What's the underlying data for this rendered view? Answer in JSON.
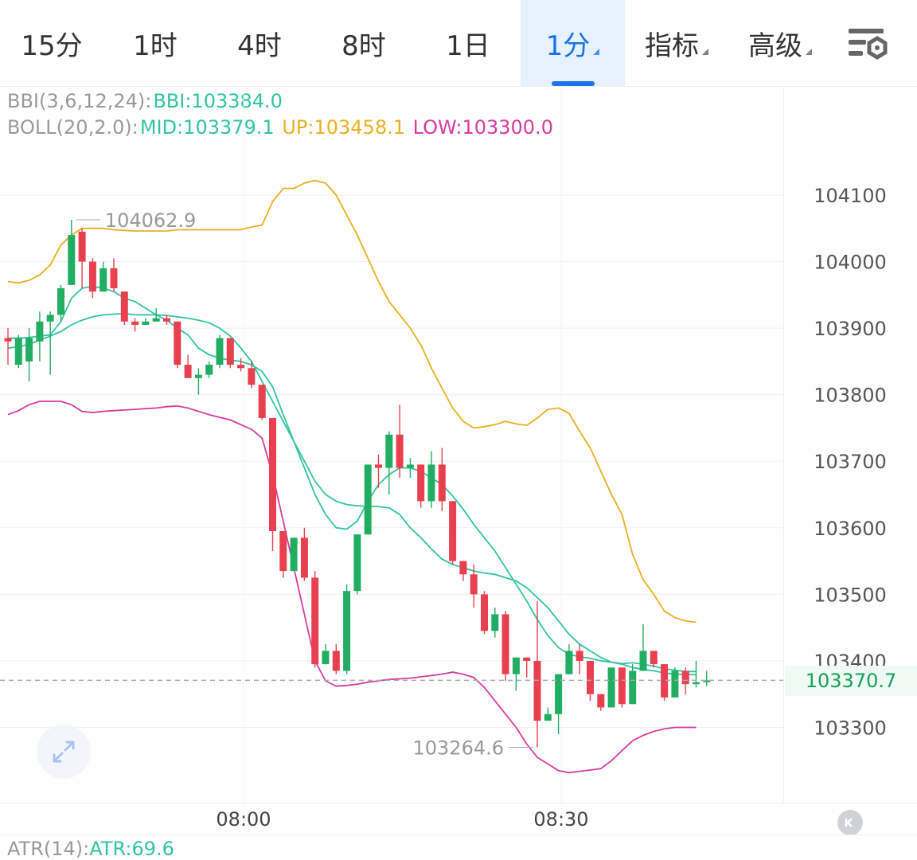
{
  "tabs": [
    {
      "label": "15分"
    },
    {
      "label": "1时"
    },
    {
      "label": "4时"
    },
    {
      "label": "8时"
    },
    {
      "label": "1日"
    },
    {
      "label": "1分"
    },
    {
      "label": "指标"
    },
    {
      "label": "高级"
    }
  ],
  "active_tab": "1分",
  "menu_icon": "settings-list-icon",
  "legend": {
    "bbi_name": "BBI(3,6,12,24):",
    "bbi_value": "BBI:103384.0",
    "boll_name": "BOLL(20,2.0):",
    "boll_mid": "MID:103379.1",
    "boll_up": "UP:103458.1",
    "boll_low": "LOW:103300.0"
  },
  "current_price": "103370.7",
  "atr": {
    "name": "ATR(14):",
    "value": "ATR:69.6"
  },
  "colors": {
    "up": "#21ad62",
    "down": "#e8404f",
    "bbi": "#2fc4a2",
    "mid": "#2fc4a2",
    "upper": "#e9b020",
    "lower": "#d93aa0",
    "accent": "#1a73e8",
    "label": "#999999"
  },
  "chart_data": {
    "type": "candlestick",
    "y_ticks": [
      "104100",
      "104000",
      "103900",
      "103800",
      "103700",
      "103600",
      "103500",
      "103400",
      "103300"
    ],
    "x_ticks": [
      {
        "label": "08:00",
        "index": 20
      },
      {
        "label": "08:30",
        "index": 50
      }
    ],
    "ylim": [
      103220,
      104240
    ],
    "high_label": "104062.9",
    "low_label": "103264.6",
    "current_price": 103370.7,
    "candles": [
      [
        103885,
        103880,
        103900,
        103845
      ],
      [
        103845,
        103885,
        103890,
        103840
      ],
      [
        103850,
        103885,
        103900,
        103820
      ],
      [
        103880,
        103910,
        103925,
        103850
      ],
      [
        103910,
        103920,
        103925,
        103830
      ],
      [
        103920,
        103960,
        103965,
        103910
      ],
      [
        103965,
        104040,
        104062.9,
        103965
      ],
      [
        104045,
        104000,
        104050,
        103960
      ],
      [
        104000,
        103955,
        104005,
        103945
      ],
      [
        103955,
        103990,
        104000,
        103955
      ],
      [
        103990,
        103960,
        104005,
        103955
      ],
      [
        103955,
        103910,
        103955,
        103905
      ],
      [
        103910,
        103905,
        103915,
        103895
      ],
      [
        103905,
        103910,
        103915,
        103905
      ],
      [
        103910,
        103915,
        103930,
        103910
      ],
      [
        103915,
        103910,
        103920,
        103905
      ],
      [
        103910,
        103845,
        103910,
        103840
      ],
      [
        103845,
        103825,
        103860,
        103825
      ],
      [
        103825,
        103830,
        103840,
        103800
      ],
      [
        103830,
        103845,
        103850,
        103825
      ],
      [
        103845,
        103885,
        103890,
        103840
      ],
      [
        103885,
        103845,
        103885,
        103840
      ],
      [
        103845,
        103840,
        103855,
        103835
      ],
      [
        103840,
        103815,
        103850,
        103810
      ],
      [
        103815,
        103765,
        103815,
        103762
      ],
      [
        103765,
        103595,
        103765,
        103565
      ],
      [
        103595,
        103535,
        103595,
        103525
      ],
      [
        103535,
        103585,
        103585,
        103535
      ],
      [
        103585,
        103525,
        103600,
        103520
      ],
      [
        103525,
        103395,
        103535,
        103390
      ],
      [
        103395,
        103415,
        103425,
        103395
      ],
      [
        103415,
        103385,
        103425,
        103380
      ],
      [
        103385,
        103505,
        103515,
        103380
      ],
      [
        103505,
        103590,
        103590,
        103500
      ],
      [
        103590,
        103695,
        103695,
        103590
      ],
      [
        103695,
        103690,
        103710,
        103660
      ],
      [
        103690,
        103740,
        103745,
        103650
      ],
      [
        103740,
        103690,
        103785,
        103675
      ],
      [
        103690,
        103695,
        103705,
        103675
      ],
      [
        103695,
        103640,
        103695,
        103630
      ],
      [
        103640,
        103695,
        103715,
        103630
      ],
      [
        103695,
        103640,
        103720,
        103625
      ],
      [
        103640,
        103550,
        103640,
        103545
      ],
      [
        103550,
        103530,
        103550,
        103520
      ],
      [
        103530,
        103500,
        103545,
        103480
      ],
      [
        103500,
        103445,
        103505,
        103440
      ],
      [
        103445,
        103470,
        103480,
        103435
      ],
      [
        103470,
        103380,
        103475,
        103370
      ],
      [
        103380,
        103405,
        103405,
        103355
      ],
      [
        103405,
        103400,
        103400,
        103375
      ],
      [
        103400,
        103310,
        103490,
        103270
      ],
      [
        103310,
        103320,
        103330,
        103310
      ],
      [
        103320,
        103380,
        103380,
        103290
      ],
      [
        103380,
        103415,
        103425,
        103380
      ],
      [
        103415,
        103400,
        103425,
        103380
      ],
      [
        103400,
        103350,
        103400,
        103340
      ],
      [
        103350,
        103330,
        103350,
        103325
      ],
      [
        103330,
        103390,
        103390,
        103330
      ],
      [
        103390,
        103335,
        103390,
        103330
      ],
      [
        103335,
        103385,
        103395,
        103335
      ],
      [
        103385,
        103415,
        103455,
        103385
      ],
      [
        103415,
        103395,
        103415,
        103390
      ],
      [
        103395,
        103345,
        103395,
        103340
      ],
      [
        103345,
        103385,
        103390,
        103345
      ],
      [
        103385,
        103365,
        103390,
        103350
      ],
      [
        103365,
        103368,
        103400,
        103360
      ],
      [
        103368,
        103370.7,
        103385,
        103362
      ]
    ],
    "boll_up": [
      103970,
      103968,
      103972,
      103980,
      103995,
      104025,
      104040,
      104050,
      104050,
      104050,
      104048,
      104047,
      104046,
      104046,
      104046,
      104046,
      104048,
      104048,
      104048,
      104048,
      104048,
      104048,
      104048,
      104052,
      104055,
      104090,
      104110,
      104110,
      104118,
      104122,
      104118,
      104100,
      104070,
      104040,
      104005,
      103970,
      103940,
      103920,
      103900,
      103875,
      103840,
      103810,
      103780,
      103760,
      103750,
      103752,
      103755,
      103760,
      103756,
      103754,
      103765,
      103778,
      103780,
      103772,
      103745,
      103720,
      103685,
      103650,
      103620,
      103560,
      103522,
      103500,
      103475,
      103465,
      103460,
      103458.1
    ],
    "bbi": [
      103885,
      103885,
      103886,
      103888,
      103890,
      103910,
      103945,
      103960,
      103963,
      103960,
      103955,
      103945,
      103940,
      103930,
      103920,
      103912,
      103900,
      103890,
      103870,
      103860,
      103855,
      103852,
      103850,
      103845,
      103835,
      103812,
      103770,
      103730,
      103690,
      103650,
      103620,
      103600,
      103598,
      103610,
      103640,
      103665,
      103680,
      103690,
      103690,
      103685,
      103675,
      103665,
      103648,
      103628,
      103605,
      103585,
      103565,
      103540,
      103515,
      103490,
      103462,
      103438,
      103420,
      103410,
      103406,
      103404,
      103400,
      103398,
      103396,
      103397,
      103395,
      103392,
      103388,
      103386,
      103384,
      103384
    ],
    "boll_mid": [
      103870,
      103872,
      103876,
      103882,
      103888,
      103895,
      103905,
      103912,
      103917,
      103920,
      103921,
      103922,
      103920,
      103920,
      103920,
      103919,
      103917,
      103915,
      103912,
      103908,
      103900,
      103888,
      103870,
      103850,
      103820,
      103790,
      103760,
      103730,
      103700,
      103670,
      103650,
      103640,
      103635,
      103633,
      103632,
      103632,
      103630,
      103620,
      103600,
      103585,
      103568,
      103553,
      103545,
      103540,
      103535,
      103532,
      103530,
      103525,
      103520,
      103510,
      103495,
      103480,
      103460,
      103440,
      103425,
      103415,
      103405,
      103398,
      103395,
      103390,
      103387,
      103385,
      103382,
      103380,
      103379.5,
      103379.1
    ],
    "boll_low": [
      103770,
      103776,
      103785,
      103790,
      103790,
      103790,
      103785,
      103775,
      103773,
      103775,
      103776,
      103777,
      103778,
      103779,
      103780,
      103782,
      103783,
      103780,
      103775,
      103770,
      103766,
      103762,
      103755,
      103748,
      103735,
      103680,
      103610,
      103540,
      103470,
      103400,
      103370,
      103362,
      103363,
      103365,
      103368,
      103370,
      103372,
      103373,
      103374,
      103376,
      103378,
      103380,
      103383,
      103380,
      103375,
      103360,
      103340,
      103320,
      103300,
      103275,
      103255,
      103245,
      103235,
      103232,
      103234,
      103236,
      103238,
      103250,
      103265,
      103280,
      103288,
      103294,
      103298,
      103300,
      103300,
      103300
    ]
  }
}
